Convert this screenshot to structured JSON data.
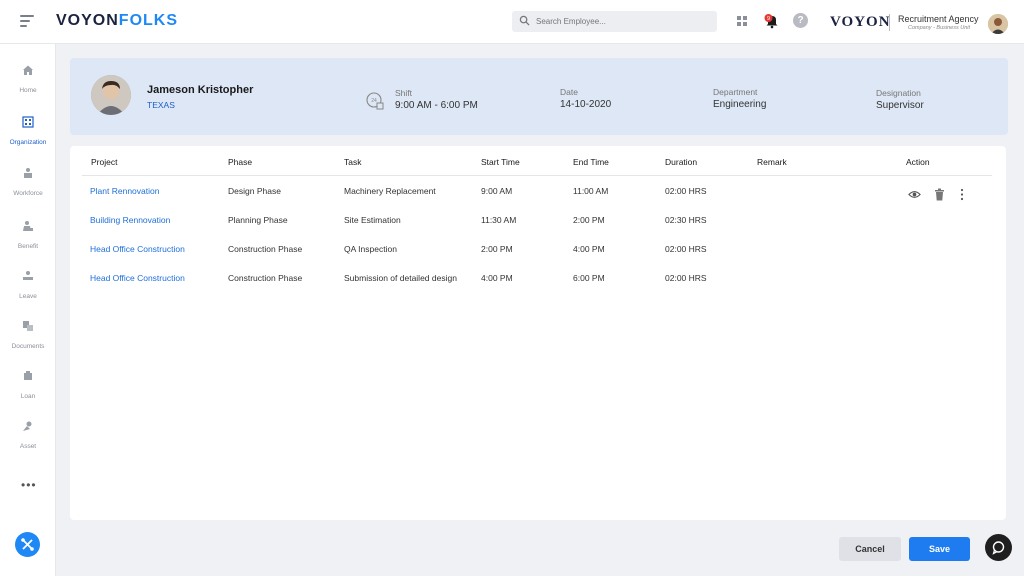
{
  "topbar": {
    "logo_main": "VOYON",
    "logo_accent": "FOLKS",
    "search_placeholder": "Search Employee...",
    "notification_count": "9",
    "brand": "VOYON",
    "agency": "Recruitment Agency",
    "agency_sub": "Company - Business Unit"
  },
  "sidebar": {
    "items": [
      {
        "label": "Home",
        "icon": "home-icon"
      },
      {
        "label": "Organization",
        "icon": "organization-icon",
        "active": true
      },
      {
        "label": "Workforce",
        "icon": "workforce-icon"
      },
      {
        "label": "Benefit",
        "icon": "benefit-icon"
      },
      {
        "label": "Leave",
        "icon": "leave-icon"
      },
      {
        "label": "Documents",
        "icon": "documents-icon"
      },
      {
        "label": "Loan",
        "icon": "loan-icon"
      },
      {
        "label": "Asset",
        "icon": "asset-icon"
      }
    ],
    "more": "•••"
  },
  "profile": {
    "name": "Jameson Kristopher",
    "location": "TEXAS",
    "shift_label": "Shift",
    "shift_value": "9:00 AM - 6:00 PM",
    "date_label": "Date",
    "date_value": "14-10-2020",
    "department_label": "Department",
    "department_value": "Engineering",
    "designation_label": "Designation",
    "designation_value": "Supervisor"
  },
  "table": {
    "headers": [
      "Project",
      "Phase",
      "Task",
      "Start Time",
      "End Time",
      "Duration",
      "Remark",
      "Action"
    ],
    "rows": [
      {
        "project": "Plant Rennovation",
        "phase": "Design Phase",
        "task": "Machinery Replacement",
        "start": "9:00 AM",
        "end": "11:00 AM",
        "duration": "02:00 HRS",
        "remark": ""
      },
      {
        "project": "Building Rennovation",
        "phase": "Planning Phase",
        "task": "Site Estimation",
        "start": "11:30 AM",
        "end": "2:00 PM",
        "duration": "02:30 HRS",
        "remark": ""
      },
      {
        "project": "Head Office Construction",
        "phase": "Construction Phase",
        "task": "QA Inspection",
        "start": "2:00 PM",
        "end": "4:00 PM",
        "duration": "02:00 HRS",
        "remark": ""
      },
      {
        "project": "Head Office Construction",
        "phase": "Construction Phase",
        "task": "Submission of detailed design",
        "start": "4:00 PM",
        "end": "6:00 PM",
        "duration": "02:00 HRS",
        "remark": ""
      }
    ]
  },
  "buttons": {
    "cancel": "Cancel",
    "save": "Save"
  },
  "colors": {
    "accent": "#1e7cf0",
    "profile_bg": "#dde7f5",
    "link": "#1e6fd9"
  }
}
